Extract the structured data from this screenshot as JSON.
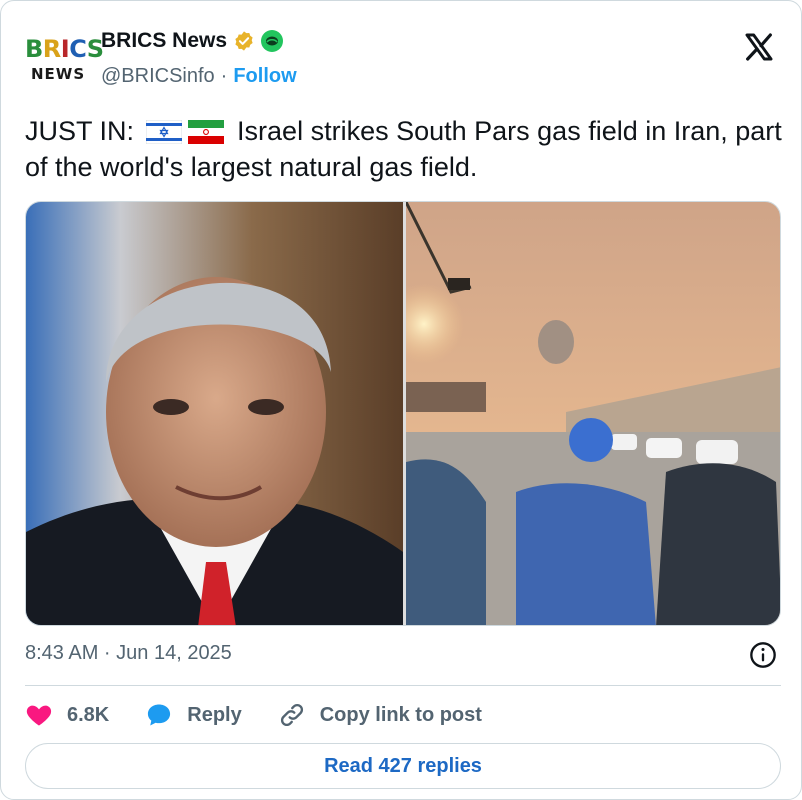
{
  "author": {
    "display_name": "BRICS News",
    "handle": "@BRICSinfo",
    "separator": "·",
    "follow_label": "Follow",
    "avatar_top_text": "BRICS",
    "avatar_bottom_text": "NEWS"
  },
  "tweet": {
    "text_prefix": "JUST IN:",
    "text_body": "Israel strikes South Pars gas field in Iran, part of the world's largest natural gas field.",
    "timestamp": "8:43 AM · Jun 14, 2025"
  },
  "actions": {
    "likes": "6.8K",
    "reply_label": "Reply",
    "copy_link_label": "Copy link to post"
  },
  "read_replies_label": "Read 427 replies",
  "colors": {
    "accent": "#1d9bf0",
    "like": "#f91880",
    "text": "#0f1419",
    "muted": "#536471",
    "border": "#cfd9de"
  },
  "icons": {
    "verified": "verified-badge-icon",
    "affiliate": "affiliate-badge-icon",
    "x_logo": "x-logo-icon",
    "info": "info-icon",
    "like": "heart-icon",
    "reply": "speech-bubble-icon",
    "copy_link": "link-icon"
  }
}
